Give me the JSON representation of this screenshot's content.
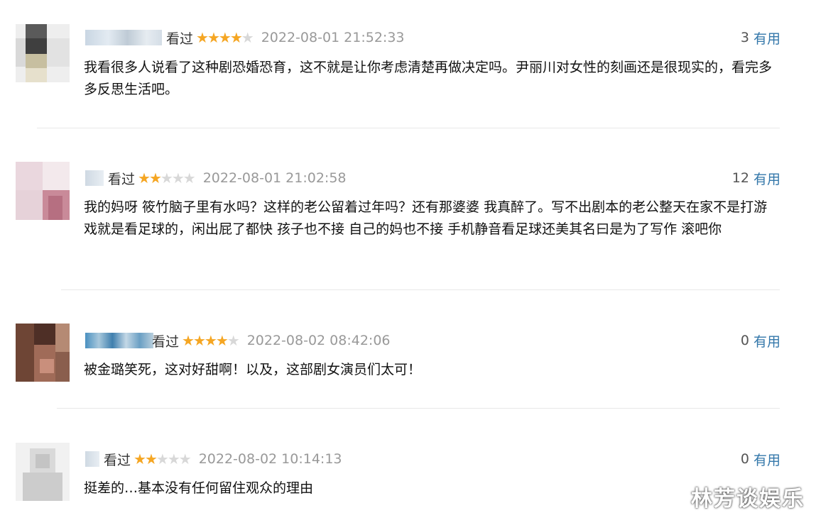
{
  "comments": [
    {
      "status": "看过",
      "rating": 4,
      "time": "2022-08-01 21:52:33",
      "useful_count": "3",
      "useful_label": "有用",
      "text": "我看很多人说看了这种剧恐婚恐育，这不就是让你考虑清楚再做决定吗。尹丽川对女性的刻画还是很现实的，看完多多反思生活吧。"
    },
    {
      "status": "看过",
      "rating": 2,
      "time": "2022-08-01 21:02:58",
      "useful_count": "12",
      "useful_label": "有用",
      "text": "我的妈呀 筱竹脑子里有水吗？这样的老公留着过年吗？还有那婆婆 我真醉了。写不出剧本的老公整天在家不是打游戏就是看足球的，闲出屁了都快 孩子也不接 自己的妈也不接 手机静音看足球还美其名曰是为了写作 滚吧你"
    },
    {
      "status": "看过",
      "rating": 4,
      "time": "2022-08-02 08:42:06",
      "useful_count": "0",
      "useful_label": "有用",
      "text": "被金璐笑死，这对好甜啊！以及，这部剧女演员们太可！"
    },
    {
      "status": "看过",
      "rating": 2,
      "time": "2022-08-02 10:14:13",
      "useful_count": "0",
      "useful_label": "有用",
      "text": "挺差的…基本没有任何留住观众的理由"
    }
  ],
  "watermark": "林芳谈娱乐",
  "colors": {
    "star_on": "#f5a623",
    "star_off": "#d8d8d8",
    "useful_link": "#3377aa",
    "time_gray": "#999999",
    "divider": "#e8e8e8"
  },
  "icons": {
    "star": "star-icon",
    "avatar": "blurred-avatar"
  }
}
